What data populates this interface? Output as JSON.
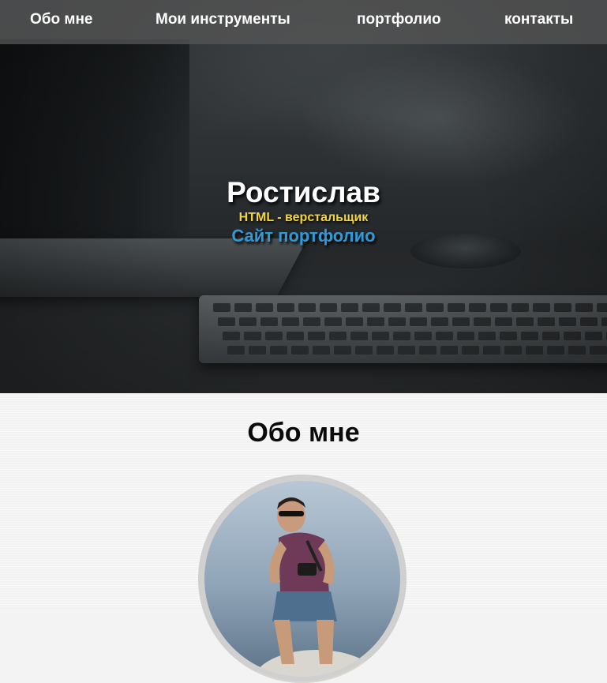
{
  "nav": {
    "items": [
      {
        "label": "Обо мне"
      },
      {
        "label": "Мои инструменты"
      },
      {
        "label": "портфолио"
      },
      {
        "label": "контакты"
      }
    ]
  },
  "hero": {
    "name": "Ростислав",
    "role": "HTML - верстальщик",
    "subtitle": "Сайт портфолио"
  },
  "about": {
    "title": "Обо мне",
    "avatar_icon": "person-photo"
  },
  "colors": {
    "nav_bg": "#545454",
    "role_text": "#f3d63a",
    "subtitle_text": "#2f9ad8",
    "about_bg": "#f2f2f2"
  }
}
